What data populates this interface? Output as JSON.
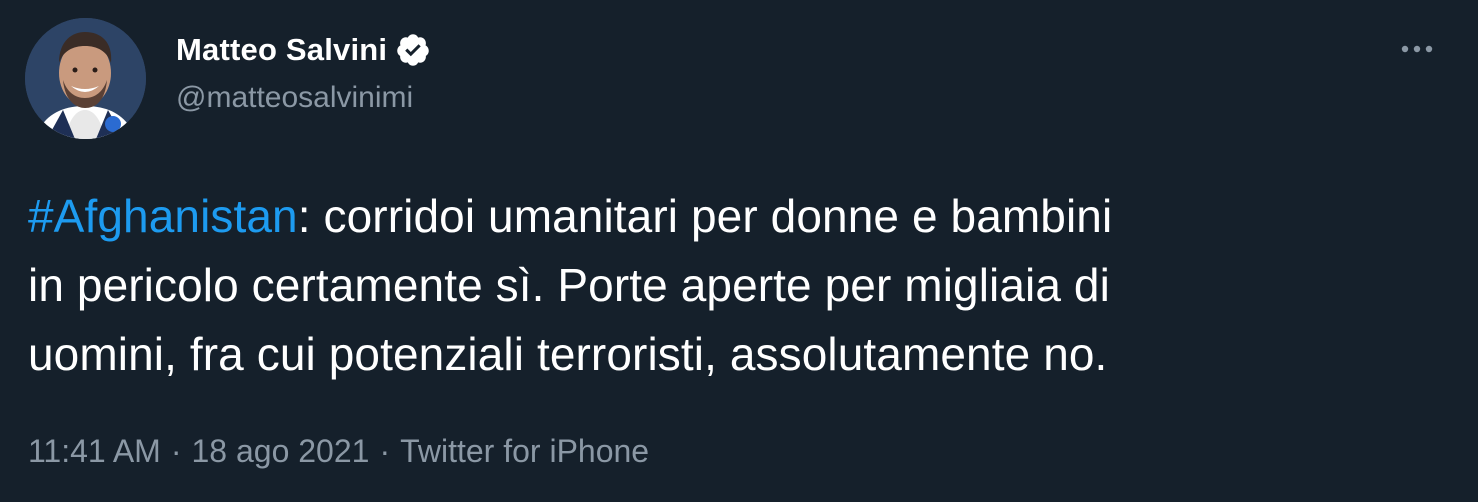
{
  "author": {
    "name": "Matteo Salvini",
    "handle": "@matteosalvinimi",
    "verified": true
  },
  "tweet": {
    "hashtag": "#Afghanistan",
    "text_line1": ": corridoi umanitari per donne e bambini",
    "text_line2": "in pericolo certamente sì. Porte aperte per migliaia di",
    "text_line3": "uomini, fra cui potenziali terroristi, assolutamente no."
  },
  "meta": {
    "time": "11:41 AM",
    "separator": "·",
    "date": "18 ago 2021",
    "source": "Twitter for iPhone"
  },
  "icons": {
    "verified": "verified-badge-icon",
    "more": "more-options-icon"
  },
  "colors": {
    "background": "#15202b",
    "text": "#ffffff",
    "secondary": "#8b98a5",
    "link": "#1d9bf0"
  }
}
